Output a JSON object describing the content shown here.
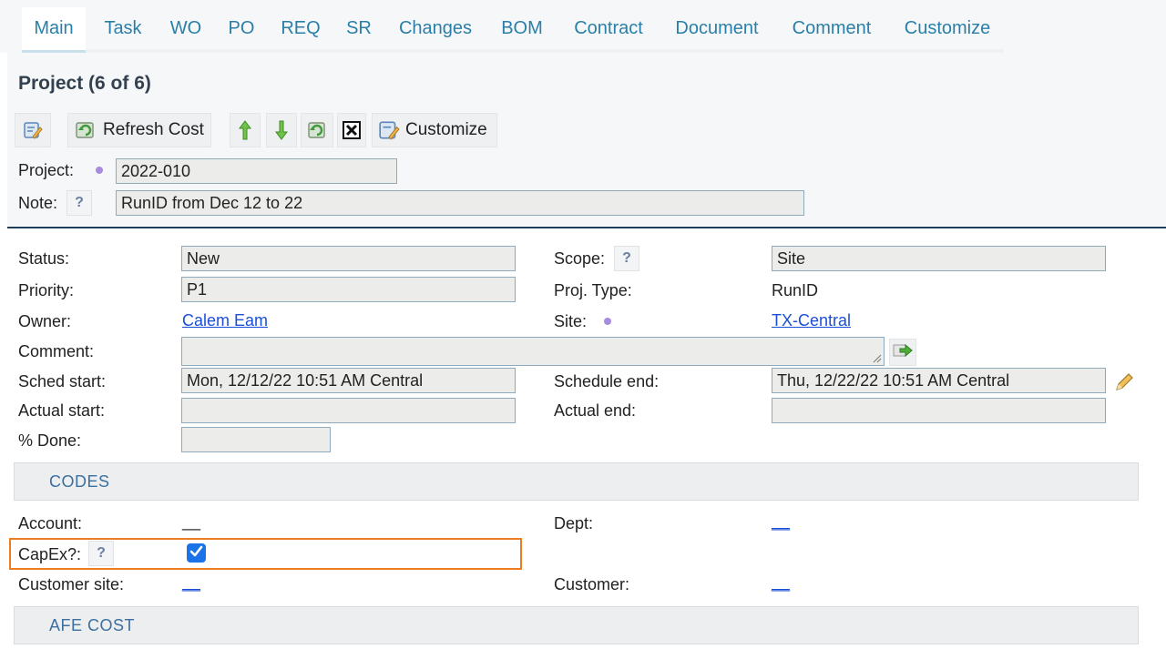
{
  "tabs": [
    "Main",
    "Task",
    "WO",
    "PO",
    "REQ",
    "SR",
    "Changes",
    "BOM",
    "Contract",
    "Document",
    "Comment",
    "Customize"
  ],
  "header": {
    "title": "Project (6 of 6)",
    "toolbar": {
      "refresh_cost": "Refresh Cost",
      "customize": "Customize"
    },
    "project_label": "Project:",
    "project_value": "2022-010",
    "note_label": "Note:",
    "note_value": "RunID from Dec 12 to 22",
    "help": "?"
  },
  "form": {
    "status_label": "Status:",
    "status_value": "New",
    "priority_label": "Priority:",
    "priority_value": "P1",
    "owner_label": "Owner:",
    "owner_value": "Calem Eam",
    "comment_label": "Comment:",
    "comment_value": "",
    "sched_start_label": "Sched start:",
    "sched_start_value": "Mon, 12/12/22 10:51 AM Central",
    "actual_start_label": "Actual start:",
    "actual_start_value": "",
    "done_label": "% Done:",
    "done_value": "",
    "scope_label": "Scope:",
    "scope_value": "Site",
    "proj_type_label": "Proj. Type:",
    "proj_type_value": "RunID",
    "site_label": "Site:",
    "site_value": "TX-Central",
    "sched_end_label": "Schedule end:",
    "sched_end_value": "Thu, 12/22/22 10:51 AM Central",
    "actual_end_label": "Actual end:",
    "actual_end_value": ""
  },
  "codes": {
    "section_title": "CODES",
    "account_label": "Account:",
    "account_value": "__",
    "dept_label": "Dept:",
    "dept_value": "__",
    "capex_label": "CapEx?:",
    "capex_checked": true,
    "customer_site_label": "Customer site:",
    "customer_site_value": "__",
    "customer_label": "Customer:",
    "customer_value": "__"
  },
  "afe": {
    "section_title": "AFE COST"
  },
  "colors": {
    "accent": "#2a7fa8",
    "link": "#1b4fd8",
    "highlight": "#ee7d22",
    "checkbox": "#1a73e8"
  }
}
